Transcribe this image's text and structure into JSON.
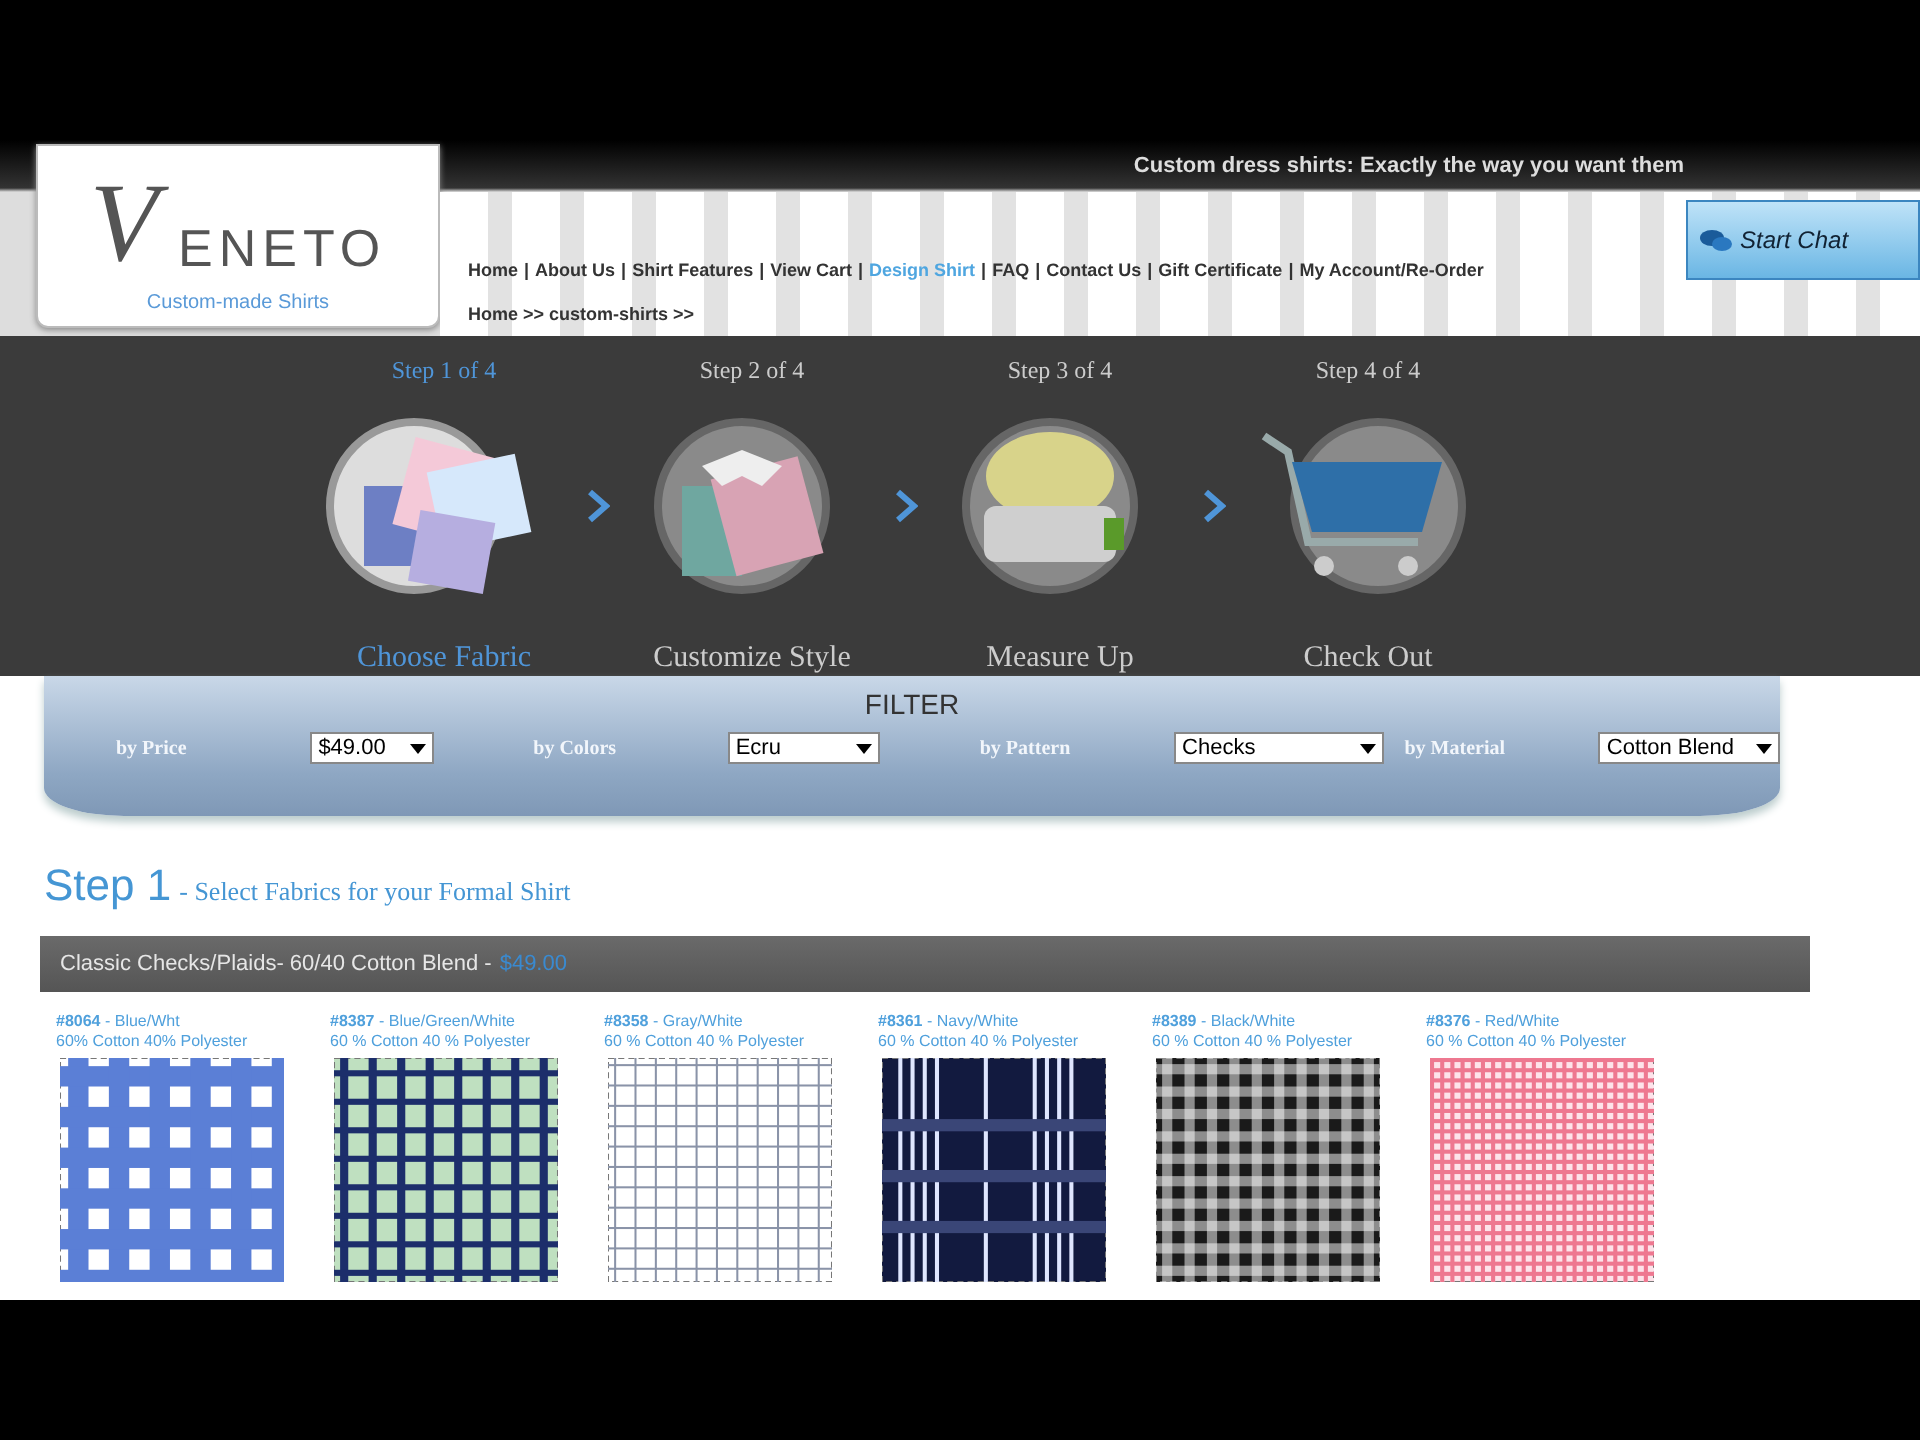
{
  "header": {
    "logo": {
      "wordmark": "ENETO",
      "initial": "V",
      "tagline": "Custom-made Shirts"
    },
    "slogan": "Custom dress shirts: Exactly the way you want them",
    "nav": [
      {
        "label": "Home",
        "selected": false
      },
      {
        "separator": "|",
        "label": "About Us",
        "selected": false
      },
      {
        "separator": "|",
        "label": "Shirt Features",
        "selected": false
      },
      {
        "separator": "|",
        "label": "View Cart",
        "selected": false
      },
      {
        "separator": "|",
        "label": "Design Shirt",
        "selected": true
      },
      {
        "separator": "|",
        "label": "FAQ",
        "selected": false
      },
      {
        "separator": "|",
        "label": "Contact Us",
        "selected": false
      },
      {
        "separator": "|",
        "label": "Gift Certificate",
        "selected": false
      },
      {
        "separator": "|",
        "label": "My Account/Re-Order",
        "selected": false
      }
    ],
    "breadcrumb": "Home >> custom-shirts >>",
    "chat_button": "Start Chat"
  },
  "steps": [
    {
      "step": "Step 1 of 4",
      "label": "Choose Fabric",
      "kind": "fabric",
      "selected": true
    },
    {
      "step": "Step 2 of 4",
      "label": "Customize Style",
      "kind": "shirt",
      "selected": false
    },
    {
      "step": "Step 3 of 4",
      "label": "Measure Up",
      "kind": "tape",
      "selected": false
    },
    {
      "step": "Step 4 of 4",
      "label": "Check Out",
      "kind": "cart",
      "selected": false
    }
  ],
  "filter": {
    "title": "FILTER",
    "fields": [
      {
        "label": "by Price",
        "value": "$49.00"
      },
      {
        "label": "by Colors",
        "value": "Ecru"
      },
      {
        "label": "by Pattern",
        "value": "Checks"
      },
      {
        "label": "by Material",
        "value": "Cotton Blend"
      }
    ]
  },
  "section": {
    "heading": "Step 1",
    "subheading": "- Select Fabrics for your Formal Shirt"
  },
  "category": {
    "title": "Classic Checks/Plaids- 60/40 Cotton Blend -",
    "price": "$49.00"
  },
  "fabrics": [
    {
      "title": "**#8064** - Blue/Wht",
      "composition": "60% Cotton 40% Polyester",
      "kind": "gingham",
      "color": "#5b7fd6"
    },
    {
      "title": "**#8387** - Blue/Green/White",
      "composition": "60 % Cotton 40 % Polyester",
      "kind": "plaid",
      "color": "#1c2e6b"
    },
    {
      "title": "**#8358** - Gray/White",
      "composition": "60 % Cotton 40 % Polyester",
      "kind": "grid",
      "color": "#8a93a8"
    },
    {
      "title": "**#8361** - Navy/White",
      "composition": "60 % Cotton 40 % Polyester",
      "kind": "tartan",
      "color": "#121a3f"
    },
    {
      "title": "**#8389** - Black/White",
      "composition": "60 % Cotton 40 % Polyester",
      "kind": "check",
      "color": "#1a1a1a"
    },
    {
      "title": "**#8376** - Red/White",
      "composition": "60 % Cotton 40 % Polyester",
      "kind": "mini",
      "color": "#ee7890"
    }
  ]
}
